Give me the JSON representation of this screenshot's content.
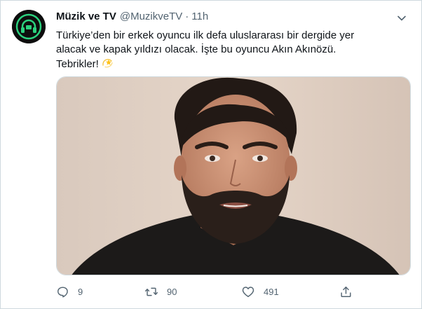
{
  "author": {
    "display_name": "Müzik ve TV",
    "handle": "@MuzikveTV",
    "separator": "·",
    "time": "11h",
    "avatar_icon": "headphones-logo-icon"
  },
  "tweet": {
    "lines": [
      "Türkiye’den bir erkek oyuncu ilk defa uluslararası bir dergide yer",
      "alacak ve kapak yıldızı olacak. İşte bu oyuncu Akın Akınözü.",
      "Tebrikler!"
    ],
    "emoji": "dizzy-star-icon"
  },
  "media": {
    "type": "photo",
    "description_icon": "portrait-photo"
  },
  "actions": {
    "reply_count": "9",
    "retweet_count": "90",
    "like_count": "491"
  },
  "colors": {
    "text": "#0f1419",
    "secondary": "#536471",
    "border": "#cfd9de",
    "avatar_accent": "#2bd17e"
  }
}
